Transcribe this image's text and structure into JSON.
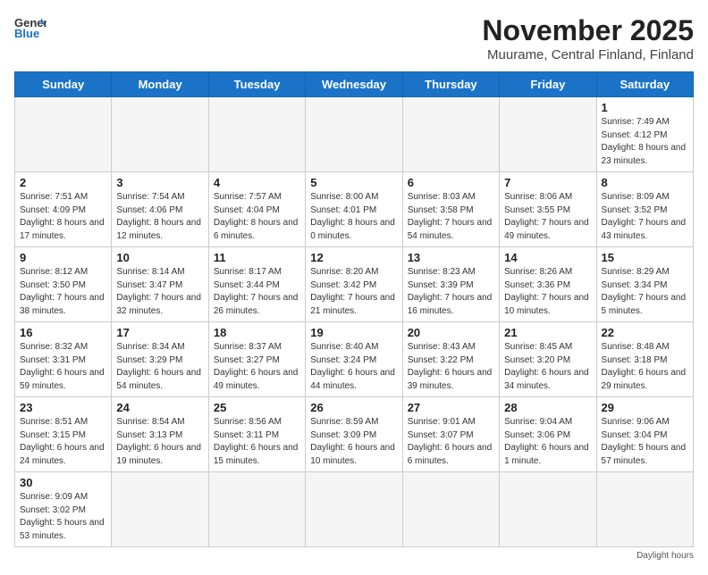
{
  "header": {
    "logo_general": "General",
    "logo_blue": "Blue",
    "month_year": "November 2025",
    "location": "Muurame, Central Finland, Finland"
  },
  "weekdays": [
    "Sunday",
    "Monday",
    "Tuesday",
    "Wednesday",
    "Thursday",
    "Friday",
    "Saturday"
  ],
  "rows": [
    [
      {
        "day": "",
        "info": ""
      },
      {
        "day": "",
        "info": ""
      },
      {
        "day": "",
        "info": ""
      },
      {
        "day": "",
        "info": ""
      },
      {
        "day": "",
        "info": ""
      },
      {
        "day": "",
        "info": ""
      },
      {
        "day": "1",
        "info": "Sunrise: 7:49 AM\nSunset: 4:12 PM\nDaylight: 8 hours and 23 minutes."
      }
    ],
    [
      {
        "day": "2",
        "info": "Sunrise: 7:51 AM\nSunset: 4:09 PM\nDaylight: 8 hours and 17 minutes."
      },
      {
        "day": "3",
        "info": "Sunrise: 7:54 AM\nSunset: 4:06 PM\nDaylight: 8 hours and 12 minutes."
      },
      {
        "day": "4",
        "info": "Sunrise: 7:57 AM\nSunset: 4:04 PM\nDaylight: 8 hours and 6 minutes."
      },
      {
        "day": "5",
        "info": "Sunrise: 8:00 AM\nSunset: 4:01 PM\nDaylight: 8 hours and 0 minutes."
      },
      {
        "day": "6",
        "info": "Sunrise: 8:03 AM\nSunset: 3:58 PM\nDaylight: 7 hours and 54 minutes."
      },
      {
        "day": "7",
        "info": "Sunrise: 8:06 AM\nSunset: 3:55 PM\nDaylight: 7 hours and 49 minutes."
      },
      {
        "day": "8",
        "info": "Sunrise: 8:09 AM\nSunset: 3:52 PM\nDaylight: 7 hours and 43 minutes."
      }
    ],
    [
      {
        "day": "9",
        "info": "Sunrise: 8:12 AM\nSunset: 3:50 PM\nDaylight: 7 hours and 38 minutes."
      },
      {
        "day": "10",
        "info": "Sunrise: 8:14 AM\nSunset: 3:47 PM\nDaylight: 7 hours and 32 minutes."
      },
      {
        "day": "11",
        "info": "Sunrise: 8:17 AM\nSunset: 3:44 PM\nDaylight: 7 hours and 26 minutes."
      },
      {
        "day": "12",
        "info": "Sunrise: 8:20 AM\nSunset: 3:42 PM\nDaylight: 7 hours and 21 minutes."
      },
      {
        "day": "13",
        "info": "Sunrise: 8:23 AM\nSunset: 3:39 PM\nDaylight: 7 hours and 16 minutes."
      },
      {
        "day": "14",
        "info": "Sunrise: 8:26 AM\nSunset: 3:36 PM\nDaylight: 7 hours and 10 minutes."
      },
      {
        "day": "15",
        "info": "Sunrise: 8:29 AM\nSunset: 3:34 PM\nDaylight: 7 hours and 5 minutes."
      }
    ],
    [
      {
        "day": "16",
        "info": "Sunrise: 8:32 AM\nSunset: 3:31 PM\nDaylight: 6 hours and 59 minutes."
      },
      {
        "day": "17",
        "info": "Sunrise: 8:34 AM\nSunset: 3:29 PM\nDaylight: 6 hours and 54 minutes."
      },
      {
        "day": "18",
        "info": "Sunrise: 8:37 AM\nSunset: 3:27 PM\nDaylight: 6 hours and 49 minutes."
      },
      {
        "day": "19",
        "info": "Sunrise: 8:40 AM\nSunset: 3:24 PM\nDaylight: 6 hours and 44 minutes."
      },
      {
        "day": "20",
        "info": "Sunrise: 8:43 AM\nSunset: 3:22 PM\nDaylight: 6 hours and 39 minutes."
      },
      {
        "day": "21",
        "info": "Sunrise: 8:45 AM\nSunset: 3:20 PM\nDaylight: 6 hours and 34 minutes."
      },
      {
        "day": "22",
        "info": "Sunrise: 8:48 AM\nSunset: 3:18 PM\nDaylight: 6 hours and 29 minutes."
      }
    ],
    [
      {
        "day": "23",
        "info": "Sunrise: 8:51 AM\nSunset: 3:15 PM\nDaylight: 6 hours and 24 minutes."
      },
      {
        "day": "24",
        "info": "Sunrise: 8:54 AM\nSunset: 3:13 PM\nDaylight: 6 hours and 19 minutes."
      },
      {
        "day": "25",
        "info": "Sunrise: 8:56 AM\nSunset: 3:11 PM\nDaylight: 6 hours and 15 minutes."
      },
      {
        "day": "26",
        "info": "Sunrise: 8:59 AM\nSunset: 3:09 PM\nDaylight: 6 hours and 10 minutes."
      },
      {
        "day": "27",
        "info": "Sunrise: 9:01 AM\nSunset: 3:07 PM\nDaylight: 6 hours and 6 minutes."
      },
      {
        "day": "28",
        "info": "Sunrise: 9:04 AM\nSunset: 3:06 PM\nDaylight: 6 hours and 1 minute."
      },
      {
        "day": "29",
        "info": "Sunrise: 9:06 AM\nSunset: 3:04 PM\nDaylight: 5 hours and 57 minutes."
      }
    ],
    [
      {
        "day": "30",
        "info": "Sunrise: 9:09 AM\nSunset: 3:02 PM\nDaylight: 5 hours and 53 minutes."
      },
      {
        "day": "",
        "info": ""
      },
      {
        "day": "",
        "info": ""
      },
      {
        "day": "",
        "info": ""
      },
      {
        "day": "",
        "info": ""
      },
      {
        "day": "",
        "info": ""
      },
      {
        "day": "",
        "info": ""
      }
    ]
  ],
  "footer": {
    "daylight_hours_label": "Daylight hours"
  }
}
